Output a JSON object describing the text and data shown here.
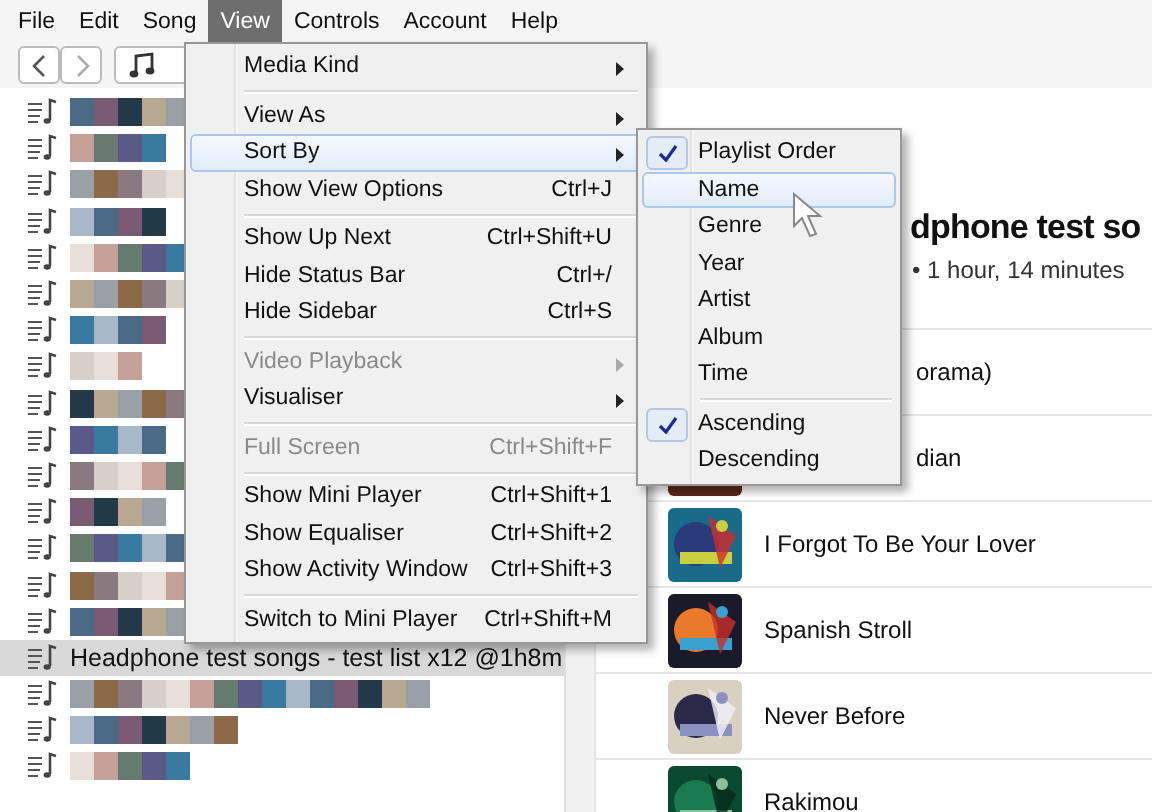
{
  "menubar": [
    {
      "label": "File",
      "selected": false
    },
    {
      "label": "Edit",
      "selected": false
    },
    {
      "label": "Song",
      "selected": false
    },
    {
      "label": "View",
      "selected": true
    },
    {
      "label": "Controls",
      "selected": false
    },
    {
      "label": "Account",
      "selected": false
    },
    {
      "label": "Help",
      "selected": false
    }
  ],
  "sidebar": {
    "playlists": [
      {
        "kind": "redacted",
        "selected": false
      },
      {
        "kind": "redacted",
        "selected": false
      },
      {
        "kind": "redacted",
        "selected": false
      },
      {
        "kind": "redacted",
        "selected": false
      },
      {
        "kind": "redacted",
        "selected": false
      },
      {
        "kind": "redacted",
        "selected": false
      },
      {
        "kind": "redacted",
        "selected": false
      },
      {
        "kind": "redacted",
        "selected": false
      },
      {
        "kind": "redacted",
        "selected": false
      },
      {
        "kind": "redacted",
        "selected": false
      },
      {
        "kind": "redacted",
        "selected": false
      },
      {
        "kind": "redacted",
        "selected": false
      },
      {
        "kind": "redacted",
        "selected": false
      },
      {
        "kind": "redacted",
        "selected": false
      },
      {
        "kind": "redacted",
        "selected": false
      },
      {
        "kind": "named",
        "label": "Headphone test songs - test list x12 @1h8m",
        "selected": true
      },
      {
        "kind": "redacted",
        "selected": false
      },
      {
        "kind": "redacted",
        "selected": false
      },
      {
        "kind": "redacted",
        "selected": false
      }
    ]
  },
  "playlist": {
    "title": "dphone test so",
    "subtitle": "• 1 hour, 14 minutes",
    "tracks": [
      {
        "kind": "covered",
        "title": "orama)"
      },
      {
        "kind": "partial",
        "title": "dian"
      },
      {
        "kind": "full",
        "title": "I Forgot To Be Your Lover"
      },
      {
        "kind": "full",
        "title": "Spanish Stroll"
      },
      {
        "kind": "full",
        "title": "Never Before"
      },
      {
        "kind": "full",
        "title": "Rakimou"
      }
    ]
  },
  "view_menu": {
    "items": [
      {
        "kind": "item",
        "label": "Media Kind",
        "submenu": true,
        "disabled": false,
        "selected": false
      },
      {
        "kind": "separator"
      },
      {
        "kind": "item",
        "label": "View As",
        "submenu": true,
        "disabled": false,
        "selected": false
      },
      {
        "kind": "item",
        "label": "Sort By",
        "submenu": true,
        "disabled": false,
        "selected": true
      },
      {
        "kind": "item",
        "label": "Show View Options",
        "shortcut": "Ctrl+J",
        "submenu": false,
        "disabled": false,
        "selected": false
      },
      {
        "kind": "separator"
      },
      {
        "kind": "item",
        "label": "Show Up Next",
        "shortcut": "Ctrl+Shift+U",
        "submenu": false,
        "disabled": false,
        "selected": false
      },
      {
        "kind": "item",
        "label": "Hide Status Bar",
        "shortcut": "Ctrl+/",
        "submenu": false,
        "disabled": false,
        "selected": false
      },
      {
        "kind": "item",
        "label": "Hide Sidebar",
        "shortcut": "Ctrl+S",
        "submenu": false,
        "disabled": false,
        "selected": false
      },
      {
        "kind": "separator"
      },
      {
        "kind": "item",
        "label": "Video Playback",
        "submenu": true,
        "disabled": true,
        "selected": false
      },
      {
        "kind": "item",
        "label": "Visualiser",
        "submenu": true,
        "disabled": false,
        "selected": false
      },
      {
        "kind": "separator"
      },
      {
        "kind": "item",
        "label": "Full Screen",
        "shortcut": "Ctrl+Shift+F",
        "submenu": false,
        "disabled": true,
        "selected": false
      },
      {
        "kind": "separator"
      },
      {
        "kind": "item",
        "label": "Show Mini Player",
        "shortcut": "Ctrl+Shift+1",
        "submenu": false,
        "disabled": false,
        "selected": false
      },
      {
        "kind": "item",
        "label": "Show Equaliser",
        "shortcut": "Ctrl+Shift+2",
        "submenu": false,
        "disabled": false,
        "selected": false
      },
      {
        "kind": "item",
        "label": "Show Activity Window",
        "shortcut": "Ctrl+Shift+3",
        "submenu": false,
        "disabled": false,
        "selected": false
      },
      {
        "kind": "separator"
      },
      {
        "kind": "item",
        "label": "Switch to Mini Player",
        "shortcut": "Ctrl+Shift+M",
        "submenu": false,
        "disabled": false,
        "selected": false
      }
    ]
  },
  "sort_menu": {
    "items": [
      {
        "kind": "item",
        "label": "Playlist Order",
        "checked": true,
        "selected": false
      },
      {
        "kind": "item",
        "label": "Name",
        "checked": false,
        "selected": true
      },
      {
        "kind": "item",
        "label": "Genre",
        "checked": false,
        "selected": false
      },
      {
        "kind": "item",
        "label": "Year",
        "checked": false,
        "selected": false
      },
      {
        "kind": "item",
        "label": "Artist",
        "checked": false,
        "selected": false
      },
      {
        "kind": "item",
        "label": "Album",
        "checked": false,
        "selected": false
      },
      {
        "kind": "item",
        "label": "Time",
        "checked": false,
        "selected": false
      },
      {
        "kind": "separator"
      },
      {
        "kind": "item",
        "label": "Ascending",
        "checked": true,
        "selected": false
      },
      {
        "kind": "item",
        "label": "Descending",
        "checked": false,
        "selected": false
      }
    ]
  }
}
